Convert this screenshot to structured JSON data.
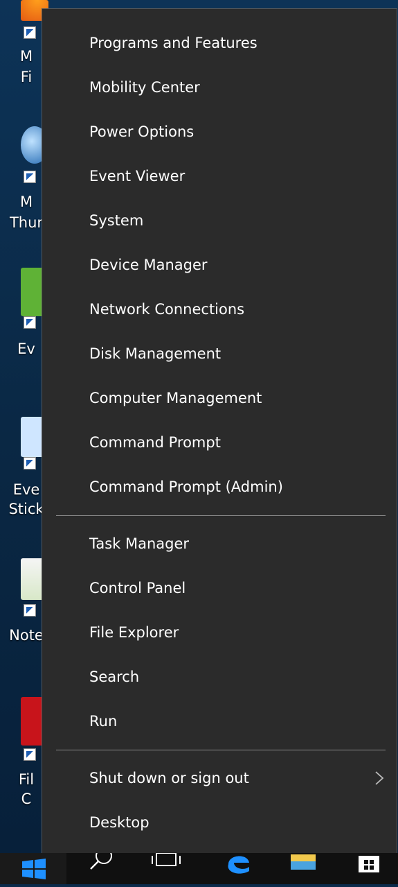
{
  "menu": {
    "items": [
      {
        "label": "Programs and Features"
      },
      {
        "label": "Mobility Center"
      },
      {
        "label": "Power Options"
      },
      {
        "label": "Event Viewer"
      },
      {
        "label": "System"
      },
      {
        "label": "Device Manager"
      },
      {
        "label": "Network Connections"
      },
      {
        "label": "Disk Management"
      },
      {
        "label": "Computer Management"
      },
      {
        "label": "Command Prompt"
      },
      {
        "label": "Command Prompt (Admin)"
      },
      {
        "label": "Task Manager"
      },
      {
        "label": "Control Panel"
      },
      {
        "label": "File Explorer"
      },
      {
        "label": "Search"
      },
      {
        "label": "Run"
      },
      {
        "label": "Shut down or sign out",
        "submenu": true,
        "submenu_icon": "chevron-right-icon"
      },
      {
        "label": "Desktop"
      }
    ]
  },
  "desktop": {
    "icons": [
      {
        "label_lines": [
          "M",
          "Fi"
        ],
        "icon": "firefox-icon"
      },
      {
        "label_lines": [
          "M",
          "Thur"
        ],
        "icon": "thunderbird-icon"
      },
      {
        "label_lines": [
          "Ev"
        ],
        "icon": "evernote-icon"
      },
      {
        "label_lines": [
          "Eve",
          "Stick"
        ],
        "icon": "sticky-notes-icon"
      },
      {
        "label_lines": [
          "Note"
        ],
        "icon": "notepad-icon"
      },
      {
        "label_lines": [
          "Fil",
          "C"
        ],
        "icon": "acrobat-icon"
      }
    ]
  },
  "taskbar": {
    "items": [
      "start-icon",
      "search-icon",
      "task-view-icon",
      "edge-icon",
      "file-explorer-icon",
      "store-icon"
    ]
  },
  "colors": {
    "menu_bg": "#2b2b2b",
    "menu_text": "#ffffff",
    "separator": "#8a8a8a",
    "taskbar_bg": "#101010",
    "start_blue": "#1e90ff"
  }
}
